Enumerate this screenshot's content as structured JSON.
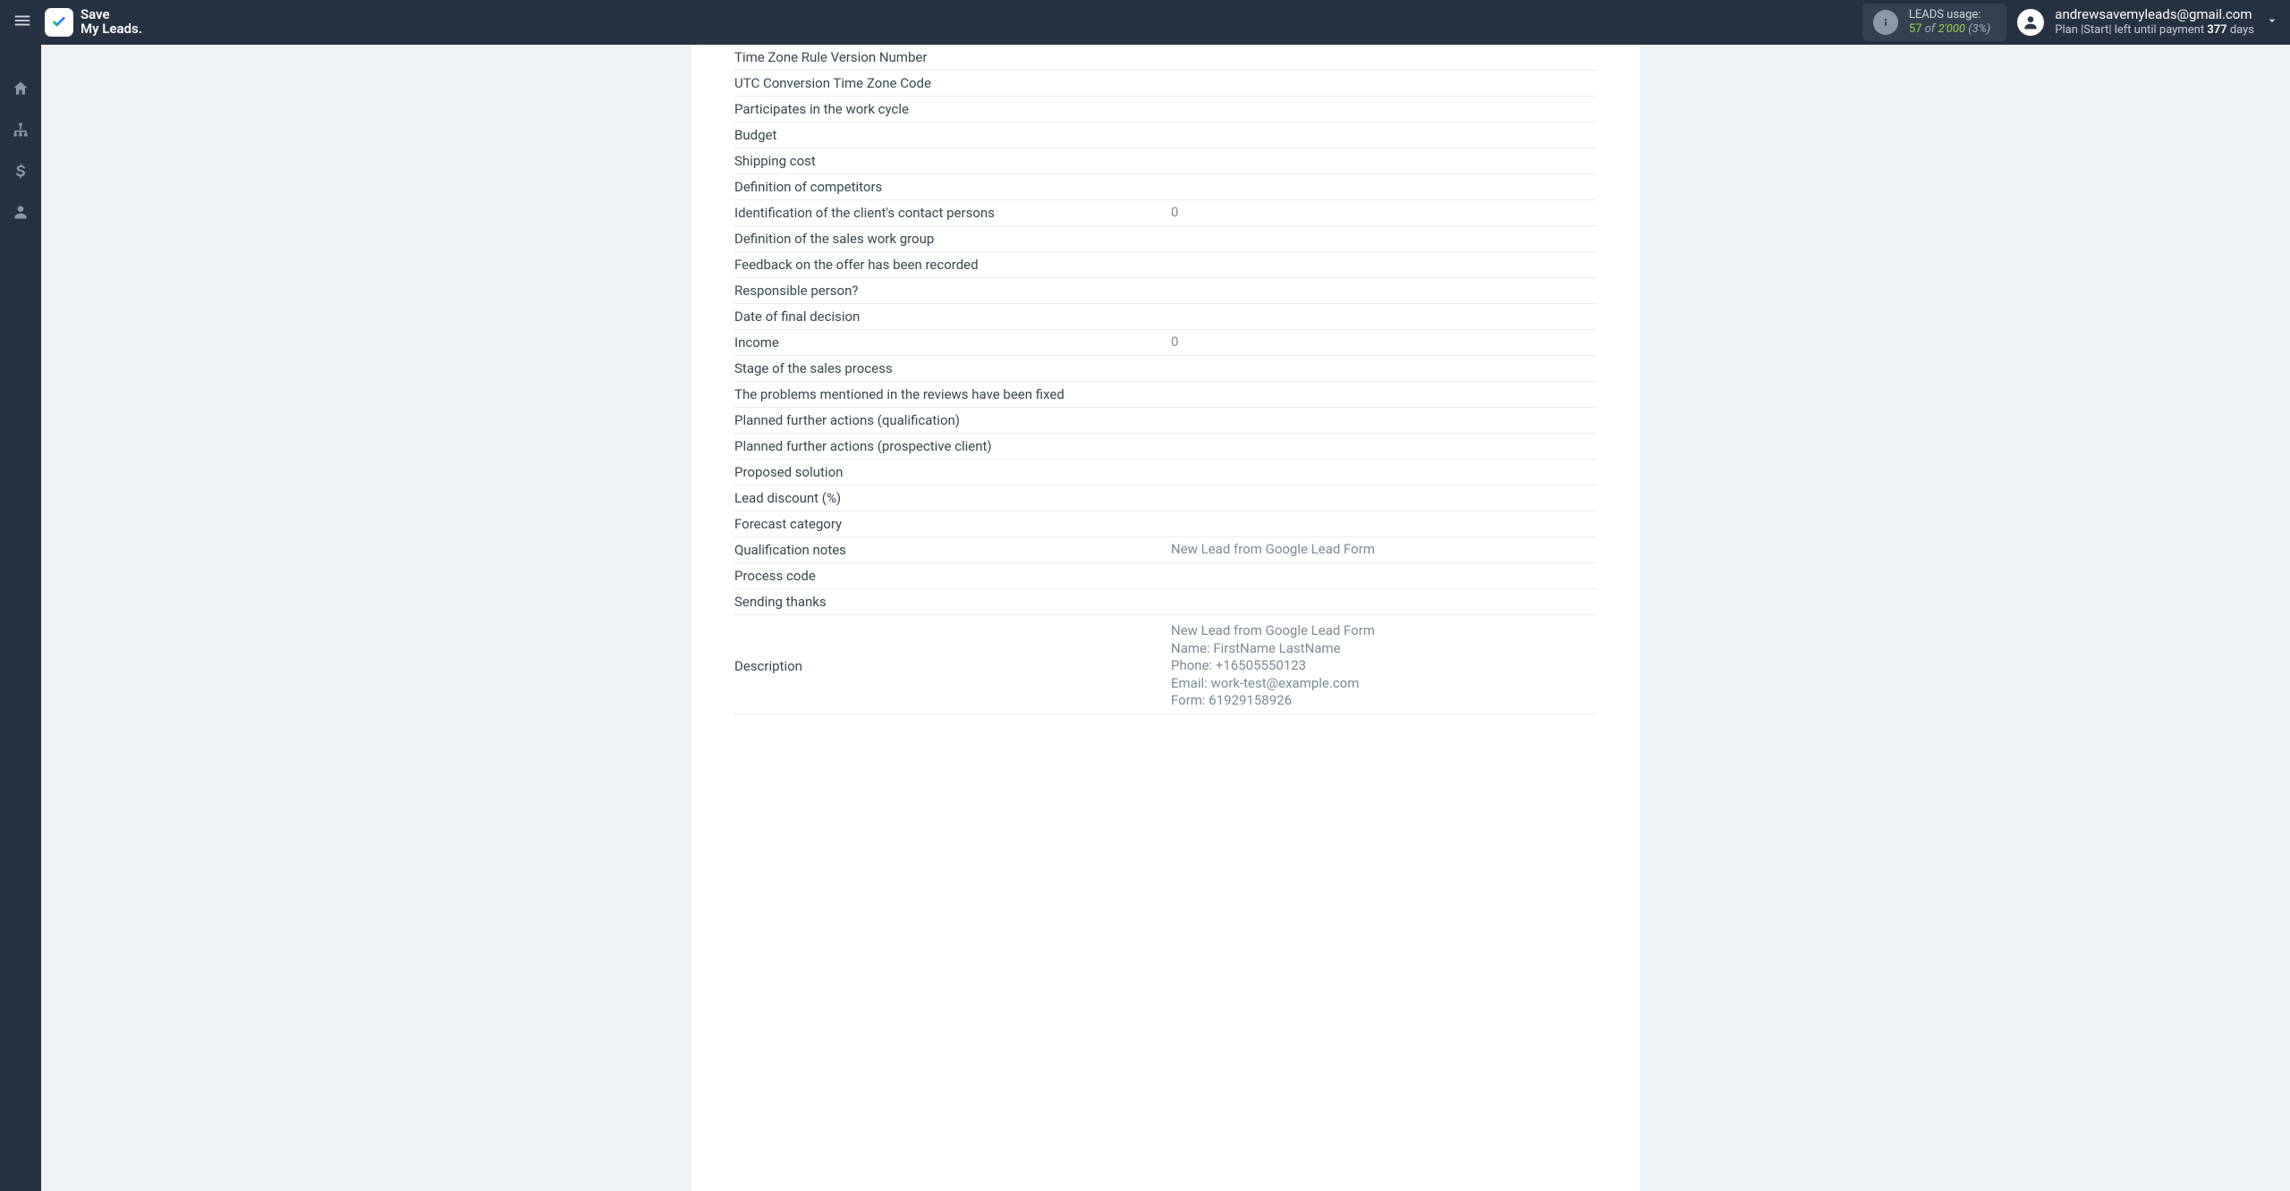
{
  "logo": {
    "line1": "Save",
    "line2": "My Leads."
  },
  "usage": {
    "label": "LEADS usage:",
    "count": "57",
    "of_word": "of",
    "limit": "2'000",
    "pct": "(3%)"
  },
  "account": {
    "email": "andrewsavemyleads@gmail.com",
    "plan_prefix": "Plan |",
    "plan_name": "Start",
    "plan_mid": "| left until payment ",
    "days_number": "377",
    "days_word": " days"
  },
  "fields": [
    {
      "label": "Time Zone Rule Version Number",
      "value": ""
    },
    {
      "label": "UTC Conversion Time Zone Code",
      "value": ""
    },
    {
      "label": "Participates in the work cycle",
      "value": ""
    },
    {
      "label": "Budget",
      "value": ""
    },
    {
      "label": "Shipping cost",
      "value": ""
    },
    {
      "label": "Definition of competitors",
      "value": ""
    },
    {
      "label": "Identification of the client's contact persons",
      "value": "0"
    },
    {
      "label": "Definition of the sales work group",
      "value": ""
    },
    {
      "label": "Feedback on the offer has been recorded",
      "value": ""
    },
    {
      "label": "Responsible person?",
      "value": ""
    },
    {
      "label": "Date of final decision",
      "value": ""
    },
    {
      "label": "Income",
      "value": "0"
    },
    {
      "label": "Stage of the sales process",
      "value": ""
    },
    {
      "label": "The problems mentioned in the reviews have been fixed",
      "value": ""
    },
    {
      "label": "Planned further actions (qualification)",
      "value": ""
    },
    {
      "label": "Planned further actions (prospective client)",
      "value": ""
    },
    {
      "label": "Proposed solution",
      "value": ""
    },
    {
      "label": "Lead discount (%)",
      "value": ""
    },
    {
      "label": "Forecast category",
      "value": ""
    },
    {
      "label": "Qualification notes",
      "value": "New Lead from Google Lead Form"
    },
    {
      "label": "Process code",
      "value": ""
    },
    {
      "label": "Sending thanks",
      "value": ""
    },
    {
      "label": "Description",
      "value": "New Lead from Google Lead Form\nName: FirstName LastName\nPhone: +16505550123\nEmail: work-test@example.com\nForm: 61929158926",
      "multiline": true
    }
  ]
}
